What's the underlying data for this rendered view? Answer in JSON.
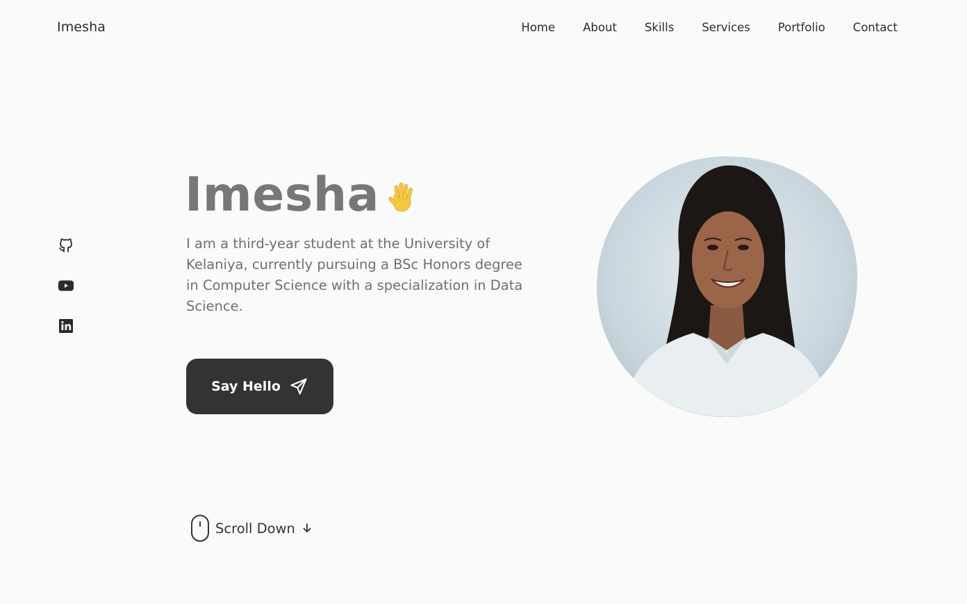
{
  "header": {
    "logo": "Imesha",
    "nav": [
      "Home",
      "About",
      "Skills",
      "Services",
      "Portfolio",
      "Contact"
    ]
  },
  "social": [
    {
      "icon": "github-icon"
    },
    {
      "icon": "youtube-icon"
    },
    {
      "icon": "linkedin-icon"
    }
  ],
  "hero": {
    "name": "Imesha",
    "wave_icon": "waving-hand-icon",
    "description": "I am a third-year student at the University of Kelaniya, currently pursuing a BSc Honors degree in Computer Science with a specialization in Data Science.",
    "button_label": "Say Hello",
    "button_icon": "send-icon",
    "scroll_label": "Scroll Down"
  },
  "colors": {
    "background": "#fafafa",
    "text": "#2b2b2b",
    "muted": "#777777",
    "button": "#333333",
    "wave": "#f5c842"
  }
}
